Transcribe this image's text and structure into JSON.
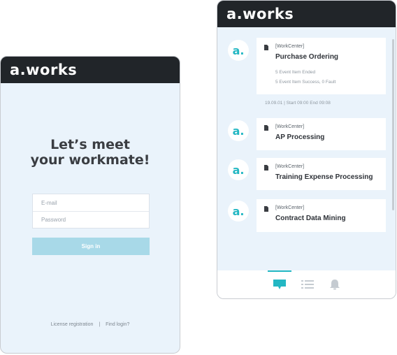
{
  "brand": {
    "logo_text": "a.works",
    "accent": "#23b7c3",
    "header_bg": "#212529"
  },
  "login": {
    "headline_line1": "Let’s meet",
    "headline_line2": "your workmate!",
    "email_placeholder": "E-mail",
    "password_placeholder": "Password",
    "signin_label": "Sign in",
    "footer_license": "License registration",
    "footer_separator": "|",
    "footer_find": "Find login?"
  },
  "feed": {
    "avatar_text": "a.",
    "items": [
      {
        "tag": "[WorkCenter]",
        "title": "Purchase Ordering",
        "meta1": "5 Event Item Ended",
        "meta2": "5 Event Item Success, 0 Fault",
        "time": "19.09.01  |  Start 09:00  End 09:08"
      },
      {
        "tag": "[WorkCenter]",
        "title": "AP Processing"
      },
      {
        "tag": "[WorkCenter]",
        "title": "Training Expense Processing"
      },
      {
        "tag": "[WorkCenter]",
        "title": "Contract Data Mining"
      }
    ]
  },
  "tabbar": {
    "tabs": [
      "chat-icon",
      "list-icon",
      "bell-icon"
    ],
    "active": "chat-icon"
  }
}
